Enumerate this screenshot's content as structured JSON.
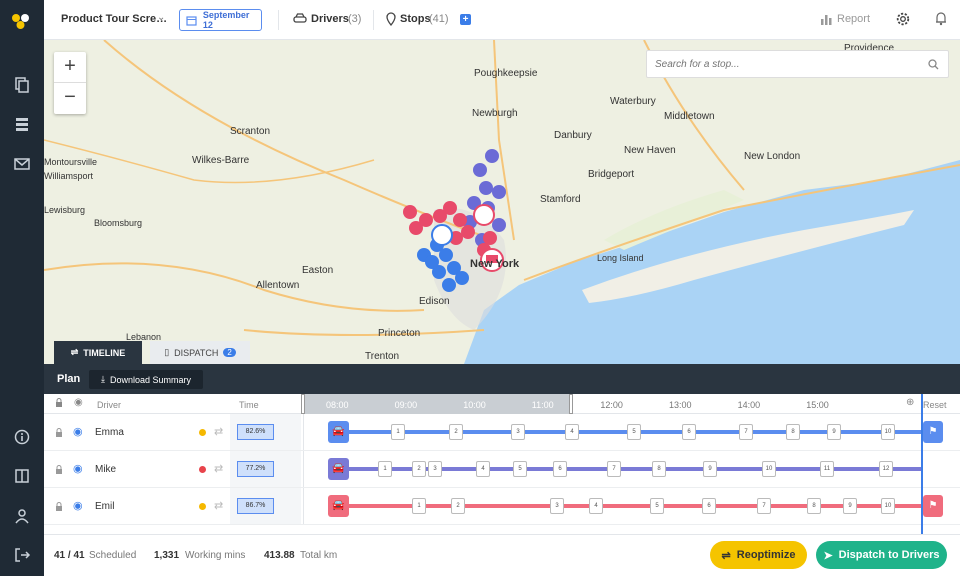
{
  "topbar": {
    "project": "Product Tour Scre…",
    "date": "September 12",
    "drivers_label": "Drivers",
    "drivers_count": "(3)",
    "stops_label": "Stops",
    "stops_count": "(41)",
    "report": "Report"
  },
  "search": {
    "placeholder": "Search for a stop..."
  },
  "map": {
    "zoom_in": "+",
    "zoom_out": "−",
    "places": [
      "Poughkeepsie",
      "Providence",
      "Scranton",
      "Newburgh",
      "Waterbury",
      "Danbury",
      "Middletown",
      "Wilkes-Barre",
      "Montoursville",
      "Williamsport",
      "New Haven",
      "New London",
      "Bridgeport",
      "Lewisburg",
      "Bloomsburg",
      "Stamford",
      "New York",
      "Long Island",
      "Easton",
      "Allentown",
      "Edison",
      "Princeton",
      "Trenton",
      "Lebanon"
    ]
  },
  "tabs": {
    "timeline": "TIMELINE",
    "dispatch": "DISPATCH",
    "dispatch_count": "2"
  },
  "plan": {
    "title": "Plan",
    "download": "Download Summary"
  },
  "columns": {
    "driver": "Driver",
    "time": "Time",
    "reset": "Reset"
  },
  "hours": [
    "08:00",
    "09:00",
    "10:00",
    "11:00",
    "12:00",
    "13:00",
    "14:00",
    "15:00"
  ],
  "drivers": [
    {
      "name": "Emma",
      "status_color": "#f5b800",
      "time": "82.6%",
      "route_color": "#5b8def",
      "stops": [
        "1",
        "2",
        "3",
        "4",
        "5",
        "6",
        "7",
        "8",
        "9",
        "10"
      ]
    },
    {
      "name": "Mike",
      "status_color": "#e8434b",
      "time": "77.2%",
      "route_color": "#7a7ad6",
      "stops": [
        "1",
        "2",
        "3",
        "4",
        "5",
        "6",
        "7",
        "8",
        "9",
        "10",
        "11",
        "12"
      ]
    },
    {
      "name": "Emil",
      "status_color": "#f5b800",
      "time": "86.7%",
      "route_color": "#f06c7d",
      "stops": [
        "1",
        "2",
        "3",
        "4",
        "5",
        "6",
        "7",
        "8",
        "9",
        "10"
      ]
    }
  ],
  "footer": {
    "scheduled": "41 / 41",
    "scheduled_label": "Scheduled",
    "mins": "1,331",
    "mins_label": "Working mins",
    "km": "413.88",
    "km_label": "Total km",
    "reoptimize": "Reoptimize",
    "dispatch": "Dispatch to Drivers"
  }
}
